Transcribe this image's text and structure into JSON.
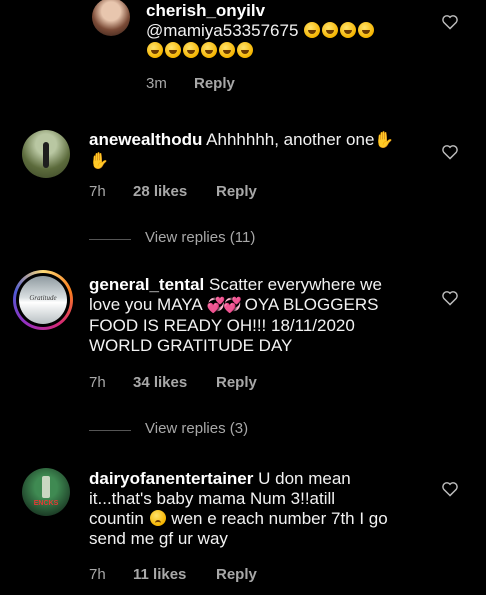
{
  "comments": [
    {
      "username": "cherish_onyilv",
      "text_line1": "@mamiya53357675",
      "time": "3m",
      "reply": "Reply",
      "colors": {
        "avatar": "#c7a48c"
      }
    },
    {
      "username": "anewealthodu",
      "text": "Ahhhhhh, another one",
      "time": "7h",
      "likes": "28 likes",
      "reply": "Reply",
      "view_replies": "View replies (11)",
      "colors": {
        "avatar": "#6f7a4f"
      }
    },
    {
      "username": "general_tental",
      "text_a": "Scatter everywhere we",
      "text_b": "love you MAYA",
      "text_c": "OYA BLOGGERS",
      "text_d": "FOOD IS READY OH!!! 18/11/2020",
      "text_e": "WORLD GRATITUDE DAY",
      "avatar_text": "Gratitude",
      "time": "7h",
      "likes": "34 likes",
      "reply": "Reply",
      "view_replies": "View replies (3)",
      "colors": {
        "avatar": "#cfd6d8",
        "ring": "#d6249f"
      }
    },
    {
      "username": "dairyofanentertainer",
      "text_a": "U don mean",
      "text_b": "it...that's baby mama Num 3!!atill",
      "text_c": "countin",
      "text_d": "wen e reach number 7th I go",
      "text_e": "send me gf ur way",
      "avatar_text": "ENCKS",
      "time": "7h",
      "likes": "11 likes",
      "reply": "Reply",
      "colors": {
        "avatar": "#2c5b3a"
      }
    }
  ],
  "icons": {
    "like": "heart-outline-icon",
    "laugh": "rolling-laughing-emoji",
    "clap": "waving-hand-emoji",
    "sad": "crying-emoji",
    "hearts": "two-hearts-emoji"
  }
}
